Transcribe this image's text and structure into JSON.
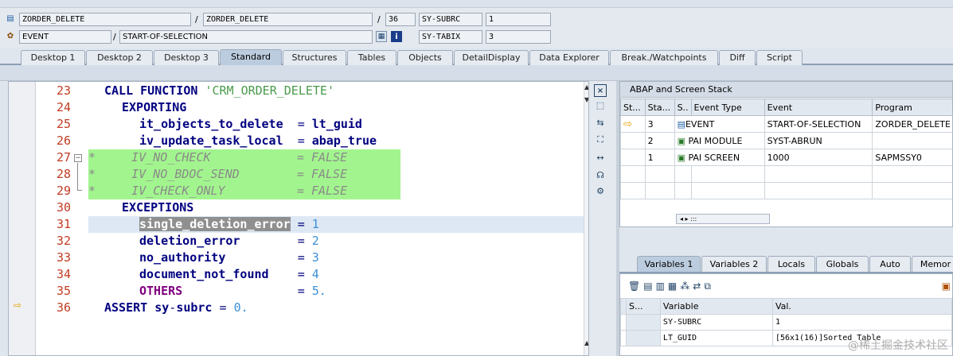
{
  "context": {
    "program": "ZORDER_DELETE",
    "include": "ZORDER_DELETE",
    "line": "36",
    "subrc_label": "SY-SUBRC",
    "subrc_value": "1",
    "event_type": "EVENT",
    "event": "START-OF-SELECTION",
    "tabix_label": "SY-TABIX",
    "tabix_value": "3",
    "slash": "/"
  },
  "tabs": [
    "Desktop 1",
    "Desktop 2",
    "Desktop 3",
    "Standard",
    "Structures",
    "Tables",
    "Objects",
    "DetailDisplay",
    "Data Explorer",
    "Break./Watchpoints",
    "Diff",
    "Script"
  ],
  "active_tab": "Standard",
  "code": {
    "line_numbers": [
      "23",
      "24",
      "25",
      "26",
      "27",
      "28",
      "29",
      "30",
      "31",
      "32",
      "33",
      "34",
      "35",
      "36"
    ],
    "l23_kw": "CALL FUNCTION",
    "l23_str": "'CRM_ORDER_DELETE'",
    "l24": "EXPORTING",
    "l25_a": "it_objects_to_delete",
    "l25_op": "=",
    "l25_b": "lt_guid",
    "l26_a": "iv_update_task_local",
    "l26_op": "=",
    "l26_b": "abap_true",
    "l27": "*     IV_NO_CHECK            = FALSE",
    "l28": "*     IV_NO_BDOC_SEND        = FALSE",
    "l29": "*     IV_CHECK_ONLY          = FALSE",
    "l30": "EXCEPTIONS",
    "l31_a": "single_deletion_error",
    "l31_op": "=",
    "l31_n": "1",
    "l32_a": "deletion_error",
    "l32_op": "=",
    "l32_n": "2",
    "l33_a": "no_authority",
    "l33_op": "=",
    "l33_n": "3",
    "l34_a": "document_not_found",
    "l34_op": "=",
    "l34_n": "4",
    "l35_a": "OTHERS",
    "l35_op": "=",
    "l35_n": "5.",
    "l36_kw": "ASSERT",
    "l36_a": "sy",
    "l36_dash": "-",
    "l36_b": "subrc",
    "l36_op": "=",
    "l36_n": "0."
  },
  "stack": {
    "title": "ABAP and Screen Stack",
    "headers": [
      "St...",
      "Sta...",
      "S..",
      "Event Type",
      "Event",
      "Program"
    ],
    "rows": [
      {
        "arrow": "⇨",
        "level": "3",
        "type": "EVENT",
        "event": "START-OF-SELECTION",
        "program": "ZORDER_DELETE"
      },
      {
        "arrow": "",
        "level": "2",
        "type": "PAI MODULE",
        "event": "SYST-ABRUN",
        "program": ""
      },
      {
        "arrow": "",
        "level": "1",
        "type": "PAI SCREEN",
        "event": "1000",
        "program": "SAPMSSY0"
      }
    ],
    "scroll_text": ":::"
  },
  "var_tabs": [
    "Variables 1",
    "Variables 2",
    "Locals",
    "Globals",
    "Auto",
    "Memor"
  ],
  "variables": {
    "headers": [
      "S...",
      "Variable",
      "Val."
    ],
    "rows": [
      {
        "name": "SY-SUBRC",
        "value": "1"
      },
      {
        "name": "LT_GUID",
        "value": "[56x1(16)]Sorted Table"
      }
    ]
  },
  "watermark": "@稀土掘金技术社区",
  "colors": {
    "comment_bg": "#a2f58e",
    "line_number": "#c23b22",
    "keyword": "#800080",
    "identifier": "#000080",
    "string": "#4a9a4a",
    "number": "#3b8fd8"
  }
}
